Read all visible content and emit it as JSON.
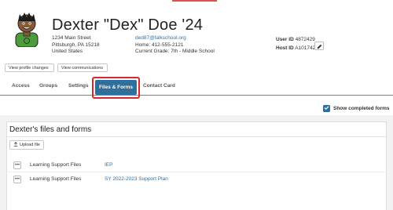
{
  "student": {
    "name": "Dexter \"Dex\" Doe '24",
    "address": [
      "1234 Main Street",
      "Pittsburgh, PA 15218",
      "United States"
    ],
    "email": "ded87@falkschool.org",
    "home_phone": "Home: 412-555-2121",
    "current_grade": "Current Grade:  7th - Middle School",
    "user_id_label": "User ID",
    "user_id": "4872429",
    "host_id_label": "Host ID",
    "host_id": "A101742"
  },
  "buttons": {
    "view_profile_changes": "View profile changes",
    "view_communications": "View communications"
  },
  "tabs": {
    "access": "Access",
    "groups": "Groups",
    "settings": "Settings",
    "files_forms": "Files & Forms",
    "contact_card": "Contact Card"
  },
  "show_completed": "Show completed forms",
  "panel": {
    "title": "Dexter's files and forms",
    "upload_label": "Upload file",
    "rows": [
      {
        "category": "Learning Support Files",
        "file": "IEP"
      },
      {
        "category": "Learning Support Files",
        "file": "SY 2022-2023 Support Plan"
      }
    ]
  },
  "icons": {
    "avatar": "student-avatar-icon",
    "edit": "pencil-icon",
    "upload": "upload-icon",
    "row_menu": "ellipsis-icon",
    "check": "checkmark-icon"
  },
  "colors": {
    "accent": "#2e6f9e",
    "highlight": "#d9262f",
    "link": "#2a6fa8"
  }
}
